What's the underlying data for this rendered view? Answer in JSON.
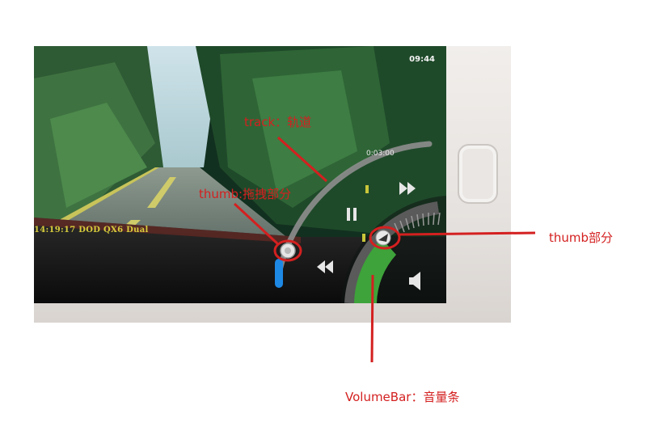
{
  "screen": {
    "clock": "09:44",
    "overlay_text": "14:19:17 DOD QX6 Dual",
    "time_readout": "0:03:00"
  },
  "controls": {
    "icons": [
      "next-icon",
      "pause-icon",
      "rewind-icon",
      "speaker-icon"
    ]
  },
  "annotations": {
    "track": "track：轨道",
    "seek_thumb": "thumb:拖拽部分",
    "volume_thumb": "thumb部分",
    "volume_bar": "VolumeBar：音量条"
  },
  "colors": {
    "annotation": "#d42020",
    "seek_progress": "#1e88e5",
    "volume_fill": "#3da33a",
    "overlay_text": "#d8cc3c"
  }
}
